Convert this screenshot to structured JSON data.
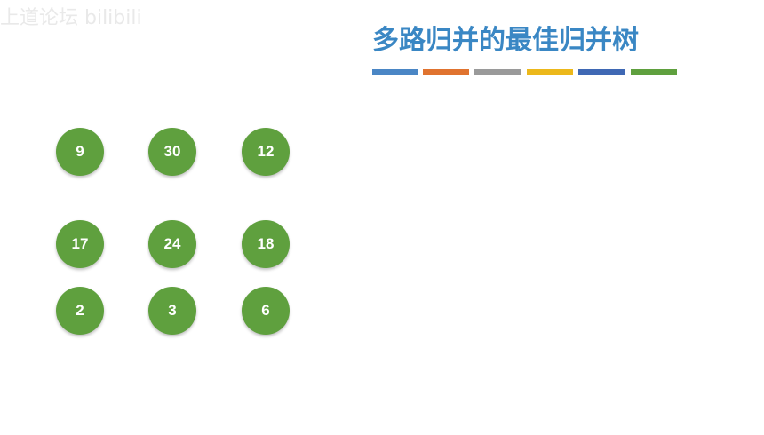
{
  "watermark": "上道论坛 bilibili",
  "title": "多路归并的最佳归并树",
  "accent_bars": [
    "#4a86c5",
    "#e0732f",
    "#9a9a9a",
    "#ecb81b",
    "#3f68b4",
    "#5fa03e"
  ],
  "node_color": "#5fa03e",
  "nodes": [
    "9",
    "30",
    "12",
    "17",
    "24",
    "18",
    "2",
    "3",
    "6"
  ]
}
